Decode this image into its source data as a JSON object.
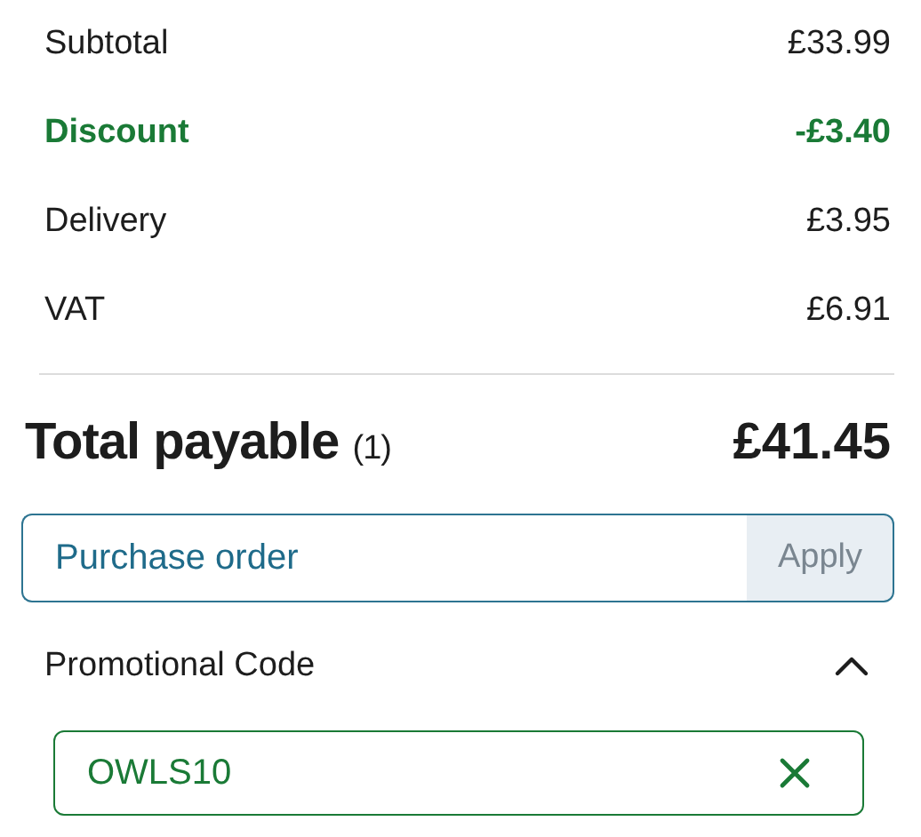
{
  "summary": [
    {
      "label": "Subtotal",
      "value": "£33.99",
      "kind": "normal"
    },
    {
      "label": "Discount",
      "value": "-£3.40",
      "kind": "discount"
    },
    {
      "label": "Delivery",
      "value": "£3.95",
      "kind": "normal"
    },
    {
      "label": "VAT",
      "value": "£6.91",
      "kind": "normal"
    }
  ],
  "total": {
    "label": "Total payable",
    "count": "(1)",
    "value": "£41.45"
  },
  "purchase_order": {
    "placeholder": "Purchase order",
    "button": "Apply"
  },
  "promo": {
    "label": "Promotional Code",
    "expanded": true,
    "value": "OWLS10"
  }
}
